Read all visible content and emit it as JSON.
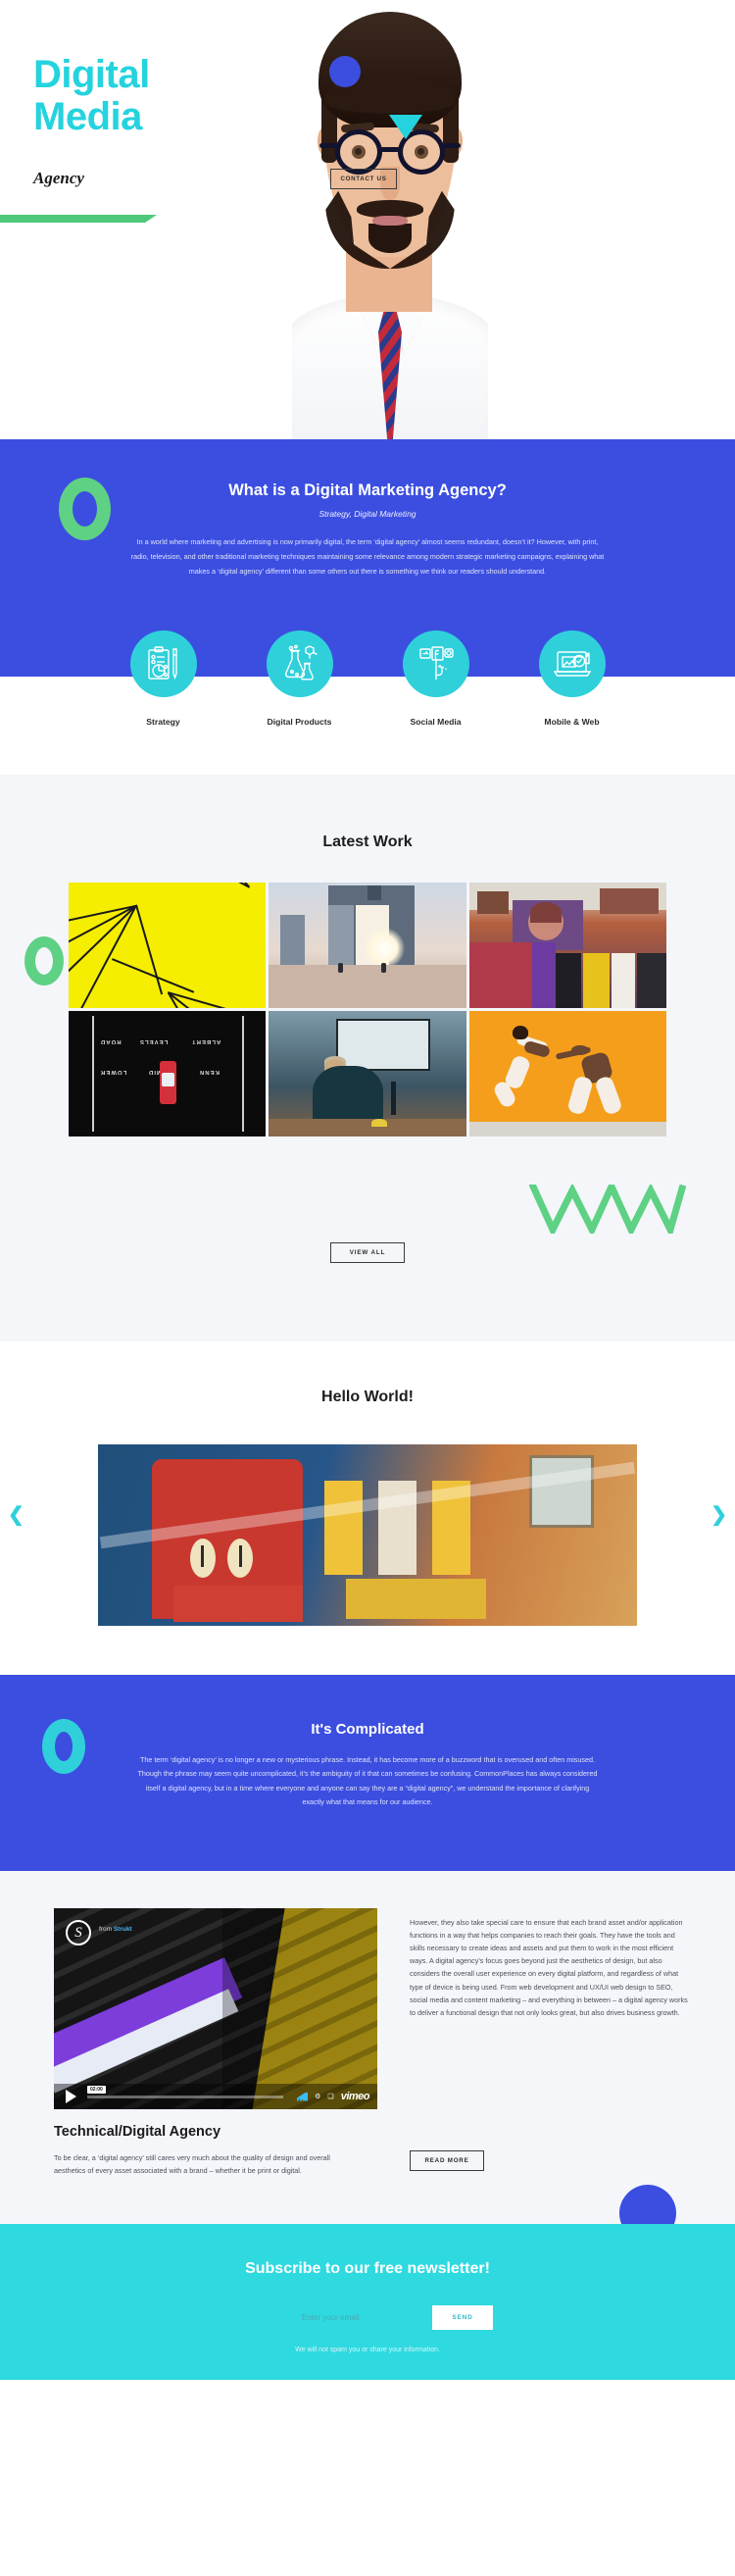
{
  "hero": {
    "title_line1": "Digital",
    "title_line2": "Media",
    "subtitle": "Agency",
    "cta_label": "CONTACT US"
  },
  "intro": {
    "heading": "What is a Digital Marketing Agency?",
    "tagline": "Strategy, Digital Marketing",
    "body": "In a world where marketing and advertising is now primarily digital, the term ‘digital agency’ almost seems redundant, doesn’t it? However, with print, radio, television, and other traditional marketing techniques maintaining some relevance among modern strategic marketing campaigns, explaining what makes a ‘digital agency’ different than some others out there is something we think our readers should understand."
  },
  "features": [
    {
      "label": "Strategy",
      "icon": "clipboard-chart-icon"
    },
    {
      "label": "Digital Products",
      "icon": "flask-molecule-icon"
    },
    {
      "label": "Social Media",
      "icon": "social-flag-icon"
    },
    {
      "label": "Mobile & Web",
      "icon": "laptop-devices-icon"
    }
  ],
  "work": {
    "title": "Latest Work",
    "view_all_label": "VIEW ALL",
    "items": [
      {
        "name": "yellow-wire-sculpture"
      },
      {
        "name": "cctv-tower-cyclists"
      },
      {
        "name": "street-art-wall"
      },
      {
        "name": "aerial-road-markings"
      },
      {
        "name": "man-at-workbench"
      },
      {
        "name": "dancers-orange-wall"
      }
    ]
  },
  "carousel": {
    "title": "Hello World!",
    "prev_label": "❮",
    "next_label": "❯",
    "slide_name": "dublin-graffiti-mural"
  },
  "complicated": {
    "heading": "It's Complicated",
    "body": "The term ‘digital agency’ is no longer a new or mysterious phrase. Instead, it has become more of a buzzword that is overused and often misused. Though the phrase may seem quite uncomplicated, it’s the ambiguity of it that can sometimes be confusing. CommonPlaces has always considered itself a digital agency, but in a time where everyone and anyone can say they are a “digital agency”, we understand the importance of clarifying exactly what that means for our audience."
  },
  "tech": {
    "video": {
      "from_prefix": "from",
      "from_author": "Strukt",
      "time": "02:00",
      "brand": "vimeo"
    },
    "heading": "Technical/Digital Agency",
    "left_body": "To be clear, a ‘digital agency’ still cares very much about the quality of design and overall aesthetics of every asset associated with a brand – whether it be print or digital.",
    "right_body": "However, they also take special care to ensure that each brand asset and/or application functions in a way that helps companies to reach their goals. They have the tools and skills necessary to create ideas and assets and put them to work in the most efficient ways.\nA digital agency’s focus goes beyond just the aesthetics of design, but also considers the overall user experience on every digital platform, and regardless of what type of device is being used. From web development and UX/UI web design to SEO, social media and content marketing – and everything in between – a digital agency works to deliver a functional design that not only looks great, but also drives business growth.",
    "read_more_label": "READ MORE"
  },
  "newsletter": {
    "heading": "Subscribe to our free newsletter!",
    "email_placeholder": "Enter your email",
    "email_value": "",
    "send_label": "SEND",
    "note": "We will not spam you or share your information."
  },
  "colors": {
    "cyan": "#2fd0da",
    "hero_cyan": "#24d3de",
    "blue": "#3b4ee0",
    "green": "#5ed184",
    "orange": "#f59e1b",
    "yellow": "#f5ee00",
    "light_bg": "#f4f6fa",
    "newsletter_bg": "#2fd9e0"
  }
}
